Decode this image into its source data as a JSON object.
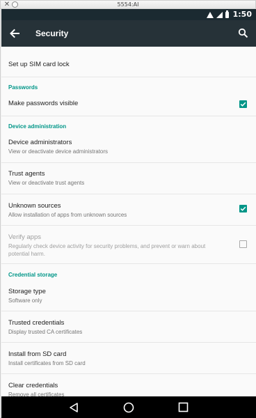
{
  "window": {
    "title": "5554:AI"
  },
  "statusbar": {
    "time": "1:50"
  },
  "appbar": {
    "title": "Security"
  },
  "settings": {
    "sim_lock": {
      "title": "Set up SIM card lock"
    },
    "passwords_header": "Passwords",
    "passwords_visible": {
      "title": "Make passwords visible",
      "checked": true
    },
    "device_admin_header": "Device administration",
    "device_administrators": {
      "title": "Device administrators",
      "subtitle": "View or deactivate device administrators"
    },
    "trust_agents": {
      "title": "Trust agents",
      "subtitle": "View or deactivate trust agents"
    },
    "unknown_sources": {
      "title": "Unknown sources",
      "subtitle": "Allow installation of apps from unknown sources",
      "checked": true
    },
    "verify_apps": {
      "title": "Verify apps",
      "subtitle_line1": "Regularly check device activity for security problems, and prevent or warn about",
      "subtitle_line2": "potential harm.",
      "checked": false,
      "enabled": false
    },
    "credential_storage_header": "Credential storage",
    "storage_type": {
      "title": "Storage type",
      "subtitle": "Software only"
    },
    "trusted_credentials": {
      "title": "Trusted credentials",
      "subtitle": "Display trusted CA certificates"
    },
    "install_sd": {
      "title": "Install from SD card",
      "subtitle": "Install certificates from SD card"
    },
    "clear_credentials": {
      "title": "Clear credentials",
      "subtitle": "Remove all certificates"
    }
  },
  "colors": {
    "accent": "#009688",
    "appbar": "#263238",
    "statusbar": "#1b2a31"
  },
  "icons": {
    "back": "arrow-left-icon",
    "search": "search-icon",
    "nav_back": "triangle-back-icon",
    "nav_home": "circle-home-icon",
    "nav_recent": "square-recents-icon"
  }
}
